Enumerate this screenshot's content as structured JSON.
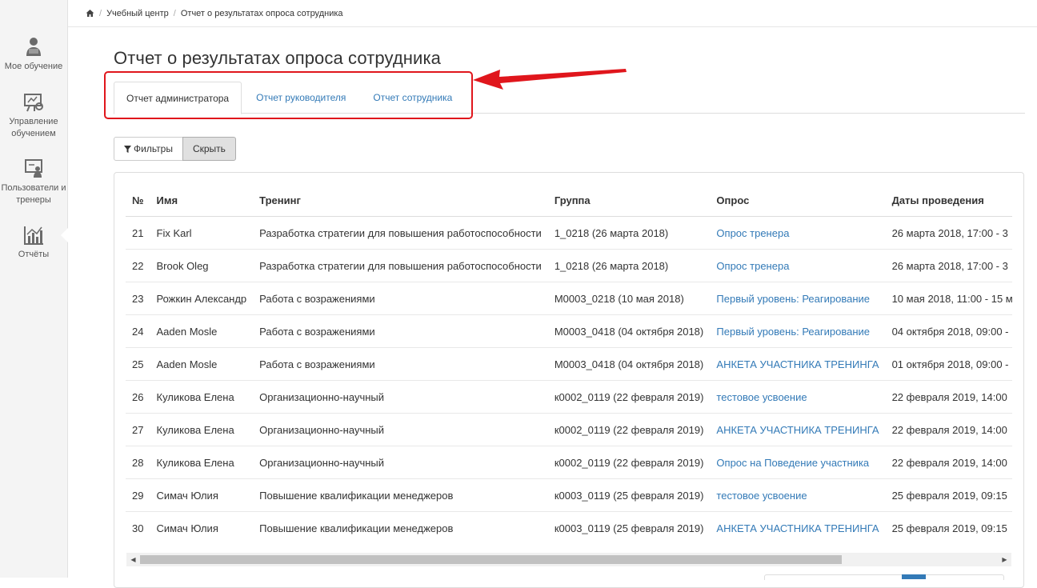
{
  "sidebar": {
    "items": [
      {
        "label": "Мое обучение",
        "icon": "student-icon"
      },
      {
        "label": "Управление обучением",
        "icon": "presentation-gear-icon"
      },
      {
        "label": "Пользователи и тренеры",
        "icon": "trainer-board-icon"
      },
      {
        "label": "Отчёты",
        "icon": "chart-icon"
      }
    ]
  },
  "breadcrumb": {
    "items": [
      "Учебный центр",
      "Отчет о результатах опроса сотрудника"
    ]
  },
  "page": {
    "title": "Отчет о результатах опроса сотрудника"
  },
  "tabs": [
    {
      "label": "Отчет администратора",
      "active": true
    },
    {
      "label": "Отчет руководителя",
      "active": false
    },
    {
      "label": "Отчет сотрудника",
      "active": false
    }
  ],
  "filters": {
    "filter_label": "Фильтры",
    "hide_label": "Скрыть"
  },
  "table": {
    "columns": [
      "№",
      "Имя",
      "Тренинг",
      "Группа",
      "Опрос",
      "Даты проведения"
    ],
    "rows": [
      {
        "no": "21",
        "name": "Fix Karl",
        "training": "Разработка стратегии для повышения работоспособности",
        "group": "1_0218 (26 марта 2018)",
        "survey": "Опрос тренера",
        "dates": "26 марта 2018, 17:00 - 3"
      },
      {
        "no": "22",
        "name": "Brook Oleg",
        "training": "Разработка стратегии для повышения работоспособности",
        "group": "1_0218 (26 марта 2018)",
        "survey": "Опрос тренера",
        "dates": "26 марта 2018, 17:00 - 3"
      },
      {
        "no": "23",
        "name": "Рожкин Александр",
        "training": "Работа с возражениями",
        "group": "М0003_0218 (10 мая 2018)",
        "survey": "Первый уровень: Реагирование",
        "dates": "10 мая 2018, 11:00 - 15 м"
      },
      {
        "no": "24",
        "name": "Aaden Mosle",
        "training": "Работа с возражениями",
        "group": "М0003_0418 (04 октября 2018)",
        "survey": "Первый уровень: Реагирование",
        "dates": "04 октября 2018, 09:00 -"
      },
      {
        "no": "25",
        "name": "Aaden Mosle",
        "training": "Работа с возражениями",
        "group": "М0003_0418 (04 октября 2018)",
        "survey": "АНКЕТА УЧАСТНИКА ТРЕНИНГА",
        "dates": "01 октября 2018, 09:00 -"
      },
      {
        "no": "26",
        "name": "Куликова Елена",
        "training": "Организационно-научный",
        "group": "к0002_0119 (22 февраля 2019)",
        "survey": "тестовое усвоение",
        "dates": "22 февраля 2019, 14:00"
      },
      {
        "no": "27",
        "name": "Куликова Елена",
        "training": "Организационно-научный",
        "group": "к0002_0119 (22 февраля 2019)",
        "survey": "АНКЕТА УЧАСТНИКА ТРЕНИНГА",
        "dates": "22 февраля 2019, 14:00"
      },
      {
        "no": "28",
        "name": "Куликова Елена",
        "training": "Организационно-научный",
        "group": "к0002_0119 (22 февраля 2019)",
        "survey": "Опрос на Поведение участника",
        "dates": "22 февраля 2019, 14:00"
      },
      {
        "no": "29",
        "name": "Симач Юлия",
        "training": "Повышение квалификации менеджеров",
        "group": "к0003_0119 (25 февраля 2019)",
        "survey": "тестовое усвоение",
        "dates": "25 февраля 2019, 09:15"
      },
      {
        "no": "30",
        "name": "Симач Юлия",
        "training": "Повышение квалификации менеджеров",
        "group": "к0003_0119 (25 февраля 2019)",
        "survey": "АНКЕТА УЧАСТНИКА ТРЕНИНГА",
        "dates": "25 февраля 2019, 09:15"
      }
    ]
  },
  "colors": {
    "link": "#337ab7",
    "annotation": "#e0161c"
  }
}
